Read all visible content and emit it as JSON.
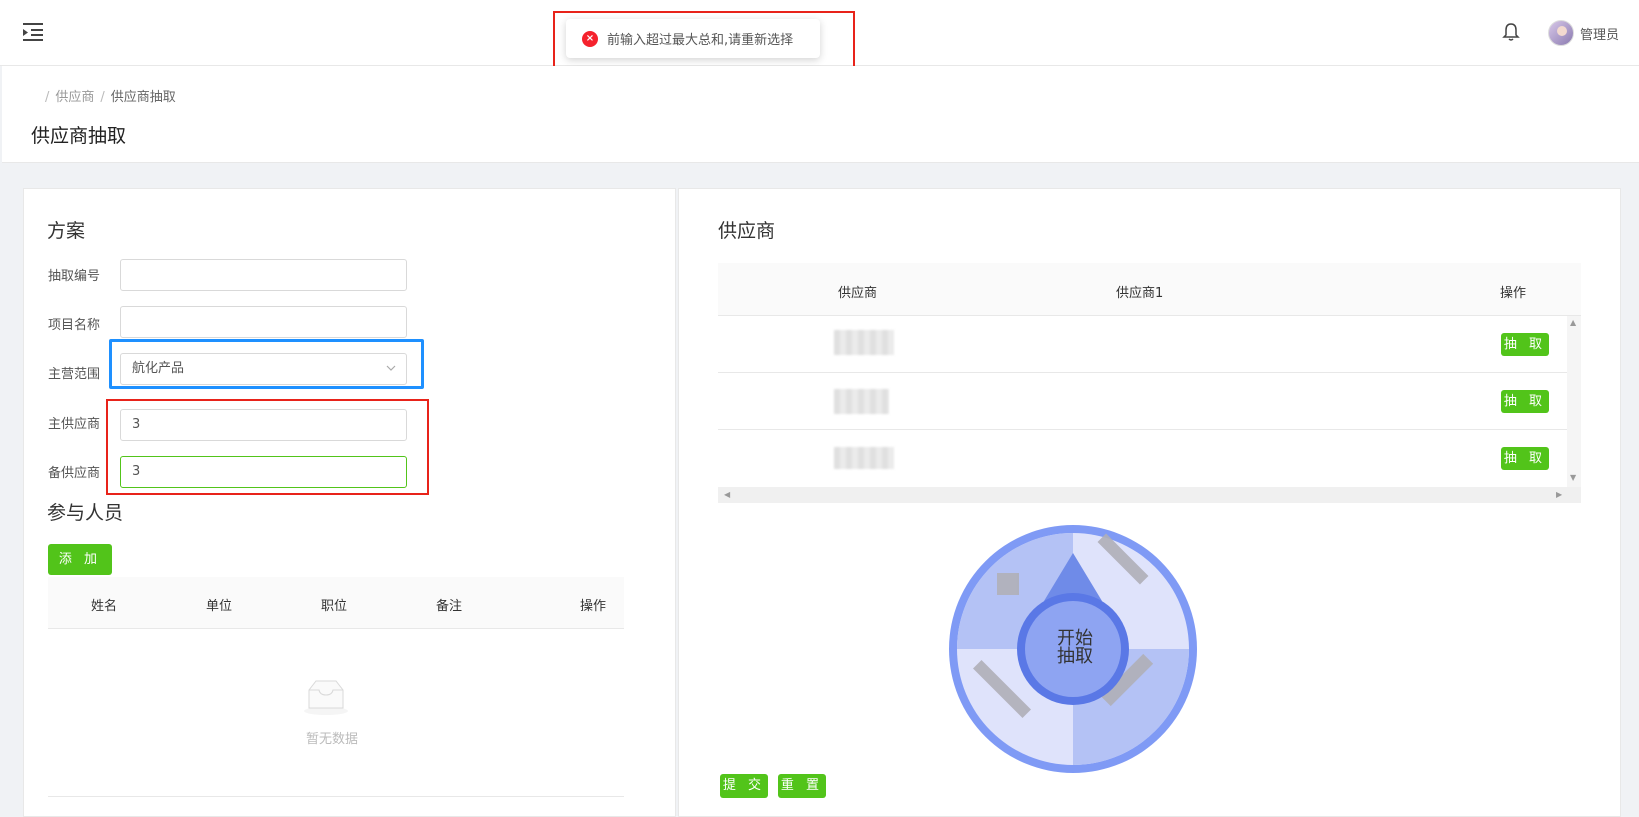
{
  "header": {
    "user_name": "管理员"
  },
  "toast": {
    "message": "前输入超过最大总和,请重新选择",
    "type": "error"
  },
  "breadcrumb": {
    "items": [
      "供应商",
      "供应商抽取"
    ]
  },
  "page": {
    "title": "供应商抽取"
  },
  "plan": {
    "title": "方案",
    "fields": {
      "draw_no": {
        "label": "抽取编号",
        "value": ""
      },
      "project_name": {
        "label": "项目名称",
        "value": ""
      },
      "scope": {
        "label": "主营范围",
        "value": "航化产品"
      },
      "main_supplier": {
        "label": "主供应商",
        "value": "3"
      },
      "backup_supplier": {
        "label": "备供应商",
        "value": "3"
      }
    }
  },
  "participants": {
    "title": "参与人员",
    "add_label": "添 加",
    "columns": [
      "姓名",
      "单位",
      "职位",
      "备注",
      "操作"
    ],
    "empty_text": "暂无数据"
  },
  "suppliers": {
    "title": "供应商",
    "columns": [
      "供应商",
      "供应商1",
      "操作"
    ],
    "rows": [
      {
        "action": "抽 取"
      },
      {
        "action": "抽 取"
      },
      {
        "action": "抽 取"
      }
    ]
  },
  "wheel": {
    "center_line1": "开始",
    "center_line2": "抽取"
  },
  "footer": {
    "submit_label": "提 交",
    "reset_label": "重 置"
  },
  "colors": {
    "accent_green": "#52c41a",
    "error_red": "#f5222d",
    "wheel_blue": "#7f9af5"
  }
}
